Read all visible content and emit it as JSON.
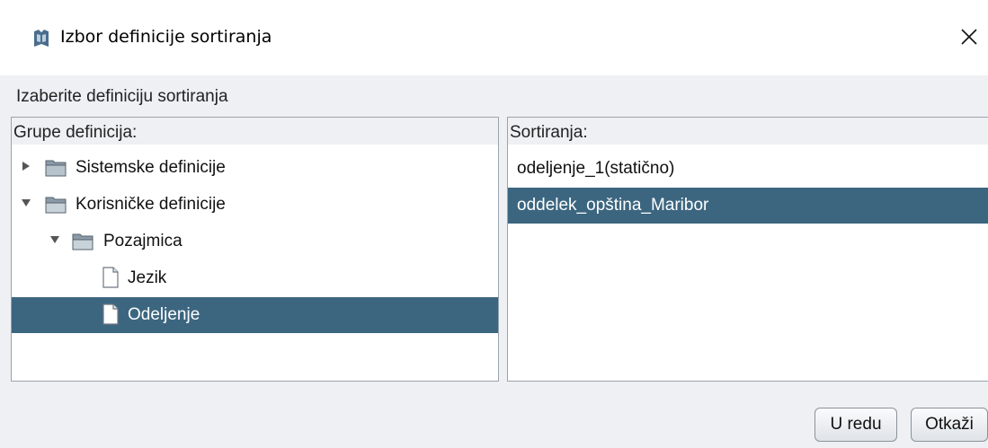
{
  "window": {
    "title": "Izbor definicije sortiranja"
  },
  "dialog": {
    "prompt": "Izaberite definiciju sortiranja"
  },
  "left_panel": {
    "header": "Grupe definicija:",
    "tree": [
      {
        "label": "Sistemske definicije",
        "icon": "folder-icon",
        "expanded": false,
        "depth": 0
      },
      {
        "label": "Korisničke definicije",
        "icon": "folder-icon",
        "expanded": true,
        "depth": 0
      },
      {
        "label": "Pozajmica",
        "icon": "folder-icon",
        "expanded": true,
        "depth": 1
      },
      {
        "label": "Jezik",
        "icon": "document-icon",
        "depth": 2
      },
      {
        "label": "Odeljenje",
        "icon": "document-icon",
        "depth": 2,
        "selected": true
      }
    ]
  },
  "right_panel": {
    "header": "Sortiranja:",
    "items": [
      {
        "label": "odeljenje_1(statično)"
      },
      {
        "label": "oddelek_opština_Maribor",
        "selected": true
      }
    ]
  },
  "buttons": {
    "ok": "U redu",
    "cancel": "Otkaži"
  },
  "colors": {
    "selection": "#3c6680",
    "dialog_background": "#eef0f3",
    "folder": "#8a9aa6"
  }
}
